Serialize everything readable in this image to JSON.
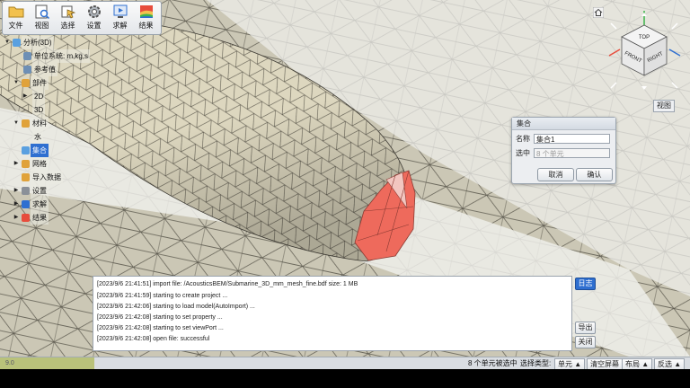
{
  "toolbar": {
    "items": [
      {
        "label": "文件",
        "icon": "folder-icon"
      },
      {
        "label": "视图",
        "icon": "view-icon"
      },
      {
        "label": "选择",
        "icon": "select-icon"
      },
      {
        "label": "设置",
        "icon": "gear-icon"
      },
      {
        "label": "求解",
        "icon": "solve-icon"
      },
      {
        "label": "结果",
        "icon": "result-icon"
      }
    ]
  },
  "tree": {
    "root": "分析(3D)",
    "unit": "单位系统: m,kg,s",
    "reference": "参考值",
    "parts": "部件",
    "part_2d": "2D",
    "part_3d": "3D",
    "material": "材料",
    "water": "水",
    "set": "集合",
    "mesh": "网格",
    "import_data": "导入数据",
    "settings": "设置",
    "solve": "求解",
    "result": "结果"
  },
  "set_dialog": {
    "title": "集合",
    "name_label": "名称",
    "name_value": "集合1",
    "selected_label": "选中",
    "selected_placeholder": "8 个单元",
    "cancel": "取消",
    "confirm": "确认"
  },
  "viewcube": {
    "top": "TOP",
    "front": "FRONT",
    "right": "RIGHT",
    "view_button": "视图"
  },
  "log": {
    "lines": [
      "[2023/9/6 21:41:51] import file: /AcousticsBEM/Submarine_3D_mm_mesh_fine.bdf size: 1 MB",
      "[2023/9/6 21:41:59] starting to create project ...",
      "[2023/9/6 21:42:06] starting to load model(AutoImport) ...",
      "[2023/9/6 21:42:08] starting to set property ...",
      "[2023/9/6 21:42:08] starting to set viewPort ...",
      "[2023/9/6 21:42:08] open file: successful"
    ],
    "log_button": "日志",
    "export_button": "导出",
    "close_button": "关闭"
  },
  "status": {
    "left_text": "9.0",
    "selected_count": "8 个单元被选中",
    "select_type_label": "选择类型:",
    "select_type_value": "单元 ▲",
    "clear_button": "清空屏幕",
    "layout_button": "布局 ▲",
    "invert_button": "反选 ▲"
  },
  "colors": {
    "accent": "#2f6fd0",
    "selection": "#f06a5a",
    "mesh": "#e2dcc2",
    "background": "#c9c5b3"
  }
}
